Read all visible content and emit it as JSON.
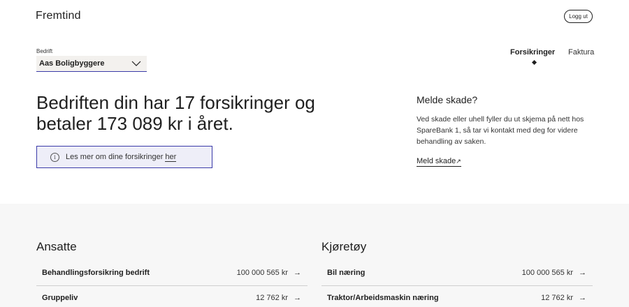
{
  "header": {
    "logo": "Fremtind",
    "logout_label": "Logg ut"
  },
  "company": {
    "label": "Bedrift",
    "selected": "Aas Boligbyggere"
  },
  "nav": {
    "tabs": [
      {
        "label": "Forsikringer",
        "active": true
      },
      {
        "label": "Faktura",
        "active": false
      }
    ]
  },
  "hero": {
    "headline": "Bedriften din har 17 forsikringer og betaler 173 089 kr i året.",
    "info_text": "Les mer om dine forsikringer",
    "info_link": "her"
  },
  "claim": {
    "title": "Melde skade?",
    "text": "Ved skade eller uhell fyller du ut skjema på nett hos SpareBank 1, så tar vi kontakt med deg for videre behandling av saken.",
    "link": "Meld skade",
    "link_icon": "↗"
  },
  "sections": [
    {
      "title": "Ansatte",
      "items": [
        {
          "name": "Behandlingsforsikring bedrift",
          "amount": "100 000 565 kr"
        },
        {
          "name": "Gruppeliv",
          "amount": "12 762 kr"
        }
      ]
    },
    {
      "title": "Kjøretøy",
      "items": [
        {
          "name": "Bil næring",
          "amount": "100 000 565 kr"
        },
        {
          "name": "Traktor/Arbeidsmaskin næring",
          "amount": "12 762 kr"
        }
      ]
    }
  ],
  "icons": {
    "arrow": "→",
    "info": "i"
  },
  "colors": {
    "accent": "#3a3aa8",
    "info_bg": "#eeeef8",
    "select_bg": "#f3f1ee",
    "section_bg": "#f7f7f7"
  }
}
